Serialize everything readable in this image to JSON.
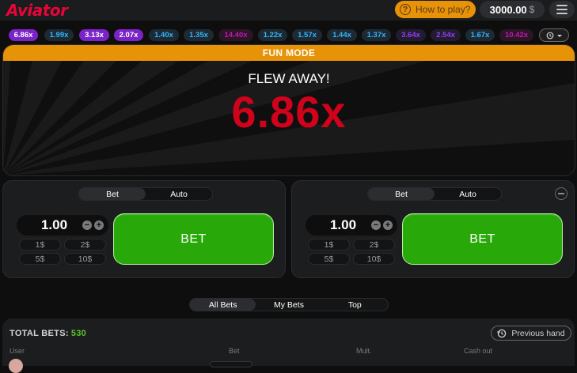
{
  "header": {
    "logo": "Aviator",
    "how_to_play": "How to play?",
    "how_to_icon": "?",
    "balance": "3000.00",
    "currency": "$",
    "menu_icon": "hamburger-menu-icon"
  },
  "history": {
    "multipliers": [
      {
        "value": "6.86x",
        "style": "purple"
      },
      {
        "value": "1.99x",
        "style": "blue"
      },
      {
        "value": "3.13x",
        "style": "purple"
      },
      {
        "value": "2.07x",
        "style": "purple"
      },
      {
        "value": "1.40x",
        "style": "blue"
      },
      {
        "value": "1.35x",
        "style": "blue"
      },
      {
        "value": "14.40x",
        "style": "pink"
      },
      {
        "value": "1.22x",
        "style": "blue"
      },
      {
        "value": "1.57x",
        "style": "blue"
      },
      {
        "value": "1.44x",
        "style": "blue"
      },
      {
        "value": "1.37x",
        "style": "blue"
      },
      {
        "value": "3.64x",
        "style": "violet"
      },
      {
        "value": "2.54x",
        "style": "violet"
      },
      {
        "value": "1.67x",
        "style": "blue"
      },
      {
        "value": "10.42x",
        "style": "pink"
      }
    ],
    "history_icon": "history-icon",
    "expand_icon": "chevron-down-icon"
  },
  "game": {
    "banner": "FUN MODE",
    "status": "FLEW AWAY!",
    "multiplier": "6.86x",
    "multiplier_color": "#d0021b"
  },
  "panels": [
    {
      "tabs": [
        "Bet",
        "Auto"
      ],
      "active_tab": "Bet",
      "amount": "1.00",
      "quick_amounts": [
        "1$",
        "2$",
        "5$",
        "10$"
      ],
      "bet_label": "BET"
    },
    {
      "tabs": [
        "Bet",
        "Auto"
      ],
      "active_tab": "Bet",
      "amount": "1.00",
      "quick_amounts": [
        "1$",
        "2$",
        "5$",
        "10$"
      ],
      "bet_label": "BET"
    }
  ],
  "bets_tabs": [
    "All Bets",
    "My Bets",
    "Top"
  ],
  "bets": {
    "total_label": "TOTAL BETS:",
    "total_count": "530",
    "previous_hand": "Previous hand",
    "columns": [
      "User",
      "Bet",
      "Mult.",
      "Cash out"
    ]
  },
  "colors": {
    "accent": "#e69308",
    "bet_green": "#28a909",
    "brand_red": "#e50539"
  }
}
